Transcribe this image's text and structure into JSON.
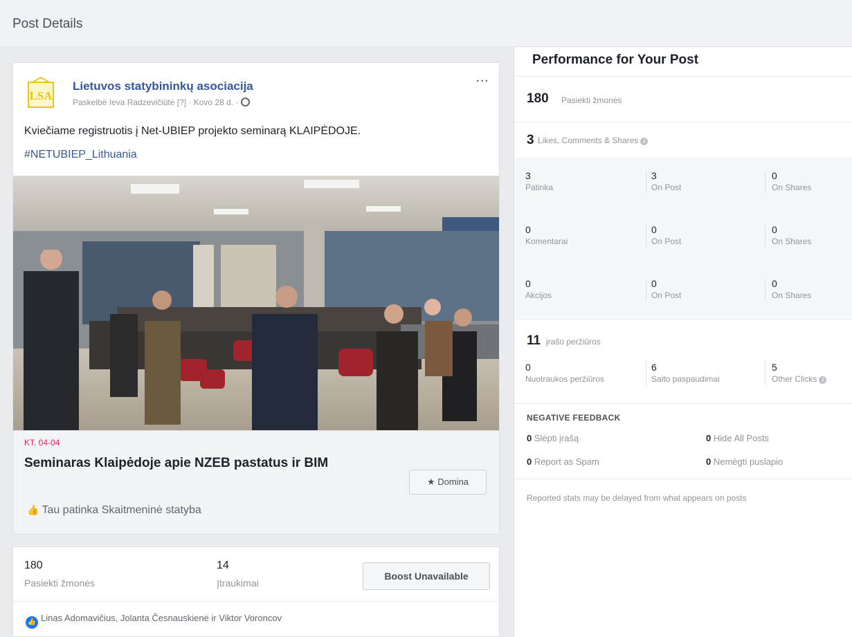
{
  "header": {
    "title": "Post Details"
  },
  "post": {
    "page_name": "Lietuvos statybininkų asociacija",
    "avatar_letters": "LSA",
    "meta": "Paskelbė Ieva Radzevičiūtė [?] · Kovo 28 d. ·",
    "more_label": "···",
    "text": "Kviečiame registruotis į Net-UBIEP projekto seminarą KLAIPĖDOJE.",
    "hashtag": "#NETUBIEP_Lithuania",
    "event": {
      "date": "KT. 04-04",
      "title": "Seminaras Klaipėdoje apie NZEB pastatus ir BIM",
      "interest_button": "Domina",
      "interest_icon": "star-icon",
      "like_text": "Tau patinka Skaitmeninė statyba"
    },
    "stats": {
      "reach_value": "180",
      "reach_label": "Pasiekti žmonės",
      "engagement_value": "14",
      "engagement_label": "Įtraukimai",
      "boost_button": "Boost Unavailable"
    },
    "reactions": "Linas Adomavičius, Jolanta Česnauskienė ir Viktor Voroncov"
  },
  "performance": {
    "title": "Performance for Your Post",
    "reach_value": "180",
    "reach_label": "Pasiekti žmonės",
    "engagement_value": "3",
    "engagement_label": "Likes, Comments & Shares",
    "rows": [
      {
        "total": "3",
        "label": "Patinka",
        "on_post": "3",
        "on_post_label": "On Post",
        "on_shares": "0",
        "on_shares_label": "On Shares"
      },
      {
        "total": "0",
        "label": "Komentarai",
        "on_post": "0",
        "on_post_label": "On Post",
        "on_shares": "0",
        "on_shares_label": "On Shares"
      },
      {
        "total": "0",
        "label": "Akcijos",
        "on_post": "0",
        "on_post_label": "On Post",
        "on_shares": "0",
        "on_shares_label": "On Shares"
      }
    ],
    "clicks_value": "11",
    "clicks_label": "įrašo peržiūros",
    "clicks": [
      {
        "value": "0",
        "label": "Nuotraukos peržiūros"
      },
      {
        "value": "6",
        "label": "Saito paspaudimai"
      },
      {
        "value": "5",
        "label": "Other Clicks"
      }
    ],
    "negative_title": "NEGATIVE FEEDBACK",
    "negative": [
      {
        "value": "0",
        "label": "Slėpti įrašą"
      },
      {
        "value": "0",
        "label": "Hide All Posts"
      },
      {
        "value": "0",
        "label": "Report as Spam"
      },
      {
        "value": "0",
        "label": "Nemėgti puslapio"
      }
    ],
    "footnote": "Reported stats may be delayed from what appears on posts"
  }
}
